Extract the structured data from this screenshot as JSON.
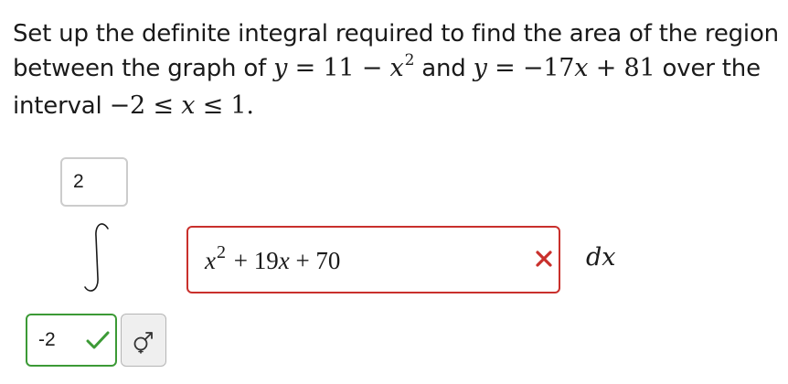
{
  "question": {
    "part1": "Set up the definite integral required to find the area of the region",
    "part2": "between the graph of",
    "eq1_var": "y",
    "eq1_rhs": " = 11 − ",
    "eq1_x": "x",
    "eq1_exp": "2",
    "and": " and ",
    "eq2_var": "y",
    "eq2_rhs1": " = −17",
    "eq2_x": "x",
    "eq2_rhs2": " + 81",
    "part3": " over the",
    "part4": "interval ",
    "interval_lhs": "−2 ≤ ",
    "interval_x": "x",
    "interval_rhs": " ≤ 1."
  },
  "upper_limit": {
    "value": "2"
  },
  "integrand": {
    "x": "x",
    "exp": "2",
    "rest_1": " + 19",
    "rest_x": "x",
    "rest_2": " + 70",
    "status": "incorrect"
  },
  "differential": "dx",
  "lower_limit": {
    "value": "-2",
    "status": "correct"
  },
  "icons": {
    "integral": "integral-sign-icon",
    "incorrect": "red-x-icon",
    "correct": "green-check-icon",
    "keypad": "math-symbols-icon"
  },
  "colors": {
    "incorrect": "#c9302c",
    "correct": "#3c9a36",
    "neutral_border": "#cccccc"
  }
}
